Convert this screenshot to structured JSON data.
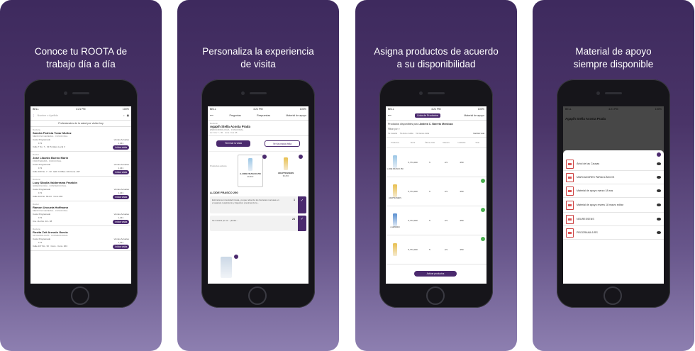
{
  "panels": [
    {
      "caption": [
        "Conoce tu ROOTA de",
        "trabajo día a día"
      ],
      "status": {
        "carrier": "BELL",
        "time": "4:21 PM",
        "battery": "100%"
      },
      "search_placeholder": "Nombre o Apellido",
      "section_title": "Profesionales de la salud por visitar hoy",
      "visit_button": "Iniciar visita",
      "contacts": [
        {
          "role": "Doctora",
          "name": "Sandra Patricia Tovar Muñoz",
          "specialty": "MEDICINA GENERAL · FUNCIONAL",
          "goal_label": "Costo Programado",
          "goal": "173",
          "sales_label": "Ventas Actuales",
          "sales": "1,231",
          "address": "Calle 7 No. 7 - 32 Portales Local 3"
        },
        {
          "role": "Doctor",
          "name": "José Libardo Bueno Marín",
          "specialty": "FISIOTERAPIA · FUNCIONAL",
          "goal_label": "Costo Programado",
          "goal": "173",
          "sales_label": "Ventas Actuales",
          "sales": "1,231",
          "address": "Calle 100 No. 7 - 33 · Edif. 9 Office 132 Cons. 207"
        },
        {
          "role": "Doctora",
          "name": "Lucy Sibolla Valderrama Franklin",
          "specialty": "GINECOLOGÍA · CONVENCIONAL",
          "goal_label": "Costo Programado",
          "goal": "173",
          "sales_label": "Ventas Actuales",
          "sales": "1,231",
          "address": "Calle 104 No. 69-04 · Cons 204"
        },
        {
          "role": "Doctor",
          "name": "Ramon Uncueta Hoffmann",
          "specialty": "MEDICINA GENERAL · FUNCIONAL",
          "goal_label": "Costo Programado",
          "goal": "173",
          "sales_label": "Ventas Actuales",
          "sales": "1,231",
          "address": "Cra. 11A No. 94 - 38"
        },
        {
          "role": "Doctora",
          "name": "Rosita Zeit Arevalo Garcia",
          "specialty": "OFTALMOLOGÍA · CONVENCIONAL",
          "goal_label": "Costo Programado",
          "goal": "173",
          "sales_label": "Ventas Actuales",
          "sales": "1,231",
          "address": "Calle 117 6A - 33 · Cons · Cons. 204"
        }
      ]
    },
    {
      "caption": [
        "Personaliza la experiencia",
        "de visita"
      ],
      "status": {
        "carrier": "BELL",
        "time": "4:21 PM",
        "battery": "100%"
      },
      "tabs": [
        "Preguntas",
        "Respuestas",
        "Material de apoyo"
      ],
      "role": "Doctora",
      "name": "Agapih Stella Acosta Prada",
      "specialty": "ENDOCRINOLOGÍA · FUNCIONAL",
      "address": "Av. Cra 7 - 30 · cons. Cos 35",
      "btn_end": "Terminar la visita",
      "btn_view": "Ver la propia visita",
      "stock_label": "Productos activos",
      "products": [
        {
          "name": "A-CIDE FRASCO 250",
          "price": "$6,800"
        },
        {
          "name": "ADAPTESSENS",
          "price": "$6,800"
        }
      ],
      "product_heading": "A-CIDE FRASCO 250",
      "notes": [
        {
          "text": "Estimula la inmunidad innata, ya que refuerza los barreras mucosas en el aparato respiratorio y digestivo previniendo la...",
          "count": "1"
        },
        {
          "text": "Se incluirá por su · planta...",
          "count": "24"
        }
      ]
    },
    {
      "caption": [
        "Asigna productos de acuerdo",
        "a su disponibilidad"
      ],
      "status": {
        "carrier": "BELL",
        "time": "4:21 PM",
        "battery": "100%"
      },
      "tab_active": "Lista de Productos",
      "tab_other": "Material de apoyo",
      "available_prefix": "Productos disponibles para",
      "doctor": "Andrea C. Barreto Mendoza",
      "filter_label": "Filtrar por",
      "legend": [
        "Ya muestra",
        "No tiene a visita",
        "No tiene a visita"
      ],
      "change_view": "Cambiar vista",
      "table_headers": [
        "Productos",
        "Stock",
        "Última visita",
        "Muestra",
        "Unidades",
        "Total"
      ],
      "products": [
        {
          "name": "A-CIDE FRASCO 250",
          "a": "5,771,000",
          "b": "5",
          "c": "2/1",
          "d": "250"
        },
        {
          "name": "ADAPTESSENS",
          "a": "5,771,000",
          "b": "5",
          "c": "2/1",
          "d": "250"
        },
        {
          "name": "A-LEPEFEN",
          "a": "5,771,000",
          "b": "5",
          "c": "2/1",
          "d": "250"
        },
        {
          "name": "",
          "a": "5,771,000",
          "b": "5",
          "c": "2/1",
          "d": "250"
        }
      ],
      "action_button": "Activar productos"
    },
    {
      "caption": [
        "Material de apoyo",
        "siempre disponible"
      ],
      "status": {
        "carrier": "BELL",
        "time": "4:21 PM",
        "battery": "100%"
      },
      "background_name": "Agapih Stella Acosta Prada",
      "materials": [
        "Árbol de las Causas",
        "MARCADORES PARACLÍNICOS",
        "Material de apoyo marzo 18 eas",
        "Material de apoyo review 18 marzo editar",
        "NEURESSENS",
        "PROGRAMA 5 RS"
      ]
    }
  ],
  "colors": {
    "brand": "#4b2a6e",
    "background_top": "#3e2a5e",
    "background_bottom": "#8d7fb0",
    "check": "#4caf50"
  }
}
